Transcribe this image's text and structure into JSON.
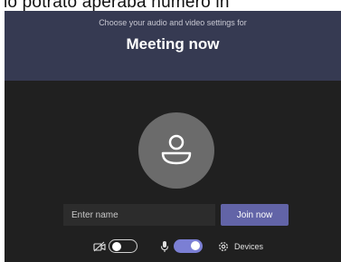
{
  "top_caption": "lo potrato aperaba numero in",
  "header": {
    "subtitle": "Choose your audio and video settings for",
    "title": "Meeting now"
  },
  "prejoin": {
    "name_placeholder": "Enter name",
    "join_label": "Join now"
  },
  "controls": {
    "camera": {
      "icon": "camera-off-icon",
      "enabled": false
    },
    "microphone": {
      "icon": "microphone-icon",
      "enabled": true
    },
    "devices": {
      "icon": "gear-icon",
      "label": "Devices"
    }
  },
  "colors": {
    "header_bg": "#363a52",
    "stage_bg": "#202020",
    "accent": "#6264a7",
    "toggle_on": "#7b7fd4"
  }
}
